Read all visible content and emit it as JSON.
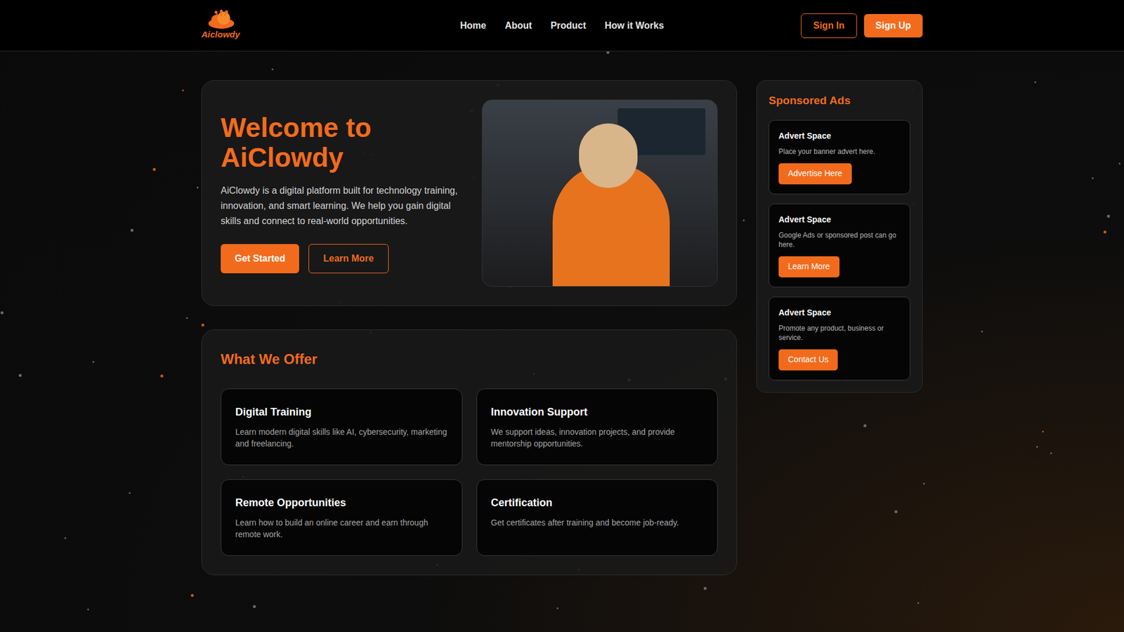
{
  "logo": {
    "text": "Aiclowdy"
  },
  "nav": {
    "links": [
      "Home",
      "About",
      "Product",
      "How it Works"
    ],
    "sign_in": "Sign In",
    "sign_up": "Sign Up"
  },
  "hero": {
    "title": "Welcome to AiClowdy",
    "description": "AiClowdy is a digital platform built for technology training, innovation, and smart learning. We help you gain digital skills and connect to real-world opportunities.",
    "primary_button": "Get Started",
    "secondary_button": "Learn More"
  },
  "offer": {
    "title": "What We Offer",
    "cards": [
      {
        "title": "Digital Training",
        "description": "Learn modern digital skills like AI, cybersecurity, marketing and freelancing."
      },
      {
        "title": "Innovation Support",
        "description": "We support ideas, innovation projects, and provide mentorship opportunities."
      },
      {
        "title": "Remote Opportunities",
        "description": "Learn how to build an online career and earn through remote work."
      },
      {
        "title": "Certification",
        "description": "Get certificates after training and become job-ready."
      }
    ]
  },
  "ads": {
    "title": "Sponsored Ads",
    "items": [
      {
        "title": "Advert Space",
        "description": "Place your banner advert here.",
        "button": "Advertise Here"
      },
      {
        "title": "Advert Space",
        "description": "Google Ads or sponsored post can go here.",
        "button": "Learn More"
      },
      {
        "title": "Advert Space",
        "description": "Promote any product, business or service.",
        "button": "Contact Us"
      }
    ]
  }
}
